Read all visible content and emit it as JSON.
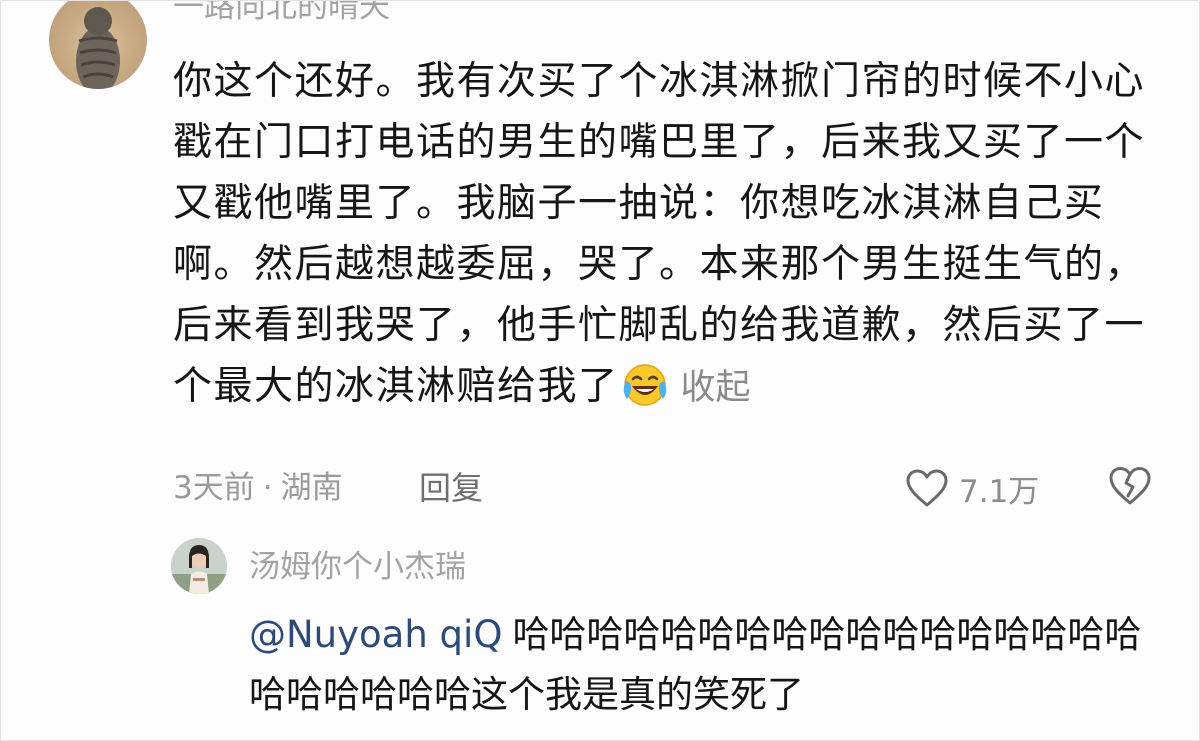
{
  "comment": {
    "username": "一路向北的晴天",
    "text": "你这个还好。我有次买了个冰淇淋掀门帘的时候不小心戳在门口打电话的男生的嘴巴里了，后来我又买了一个又戳他嘴里了。我脑子一抽说：你想吃冰淇淋自己买啊。然后越想越委屈，哭了。本来那个男生挺生气的，后来看到我哭了，他手忙脚乱的给我道歉，然后买了一个最大的冰淇淋赔给我了",
    "emoji": "laughing-crying-emoji",
    "collapse_label": "收起",
    "time": "3天前",
    "separator": "·",
    "location": "湖南",
    "reply_label": "回复",
    "like_count": "7.1万",
    "like_icon": "heart-icon",
    "dislike_icon": "broken-heart-icon"
  },
  "reply": {
    "username": "汤姆你个小杰瑞",
    "mention": "@Nuyoah qiQ",
    "text": "哈哈哈哈哈哈哈哈哈哈哈哈哈哈哈哈哈哈哈哈哈哈哈这个我是真的笑死了"
  },
  "colors": {
    "text": "#161616",
    "muted": "#a3a3a3",
    "mention": "#2d4a7a",
    "background": "#fdfdfd"
  }
}
